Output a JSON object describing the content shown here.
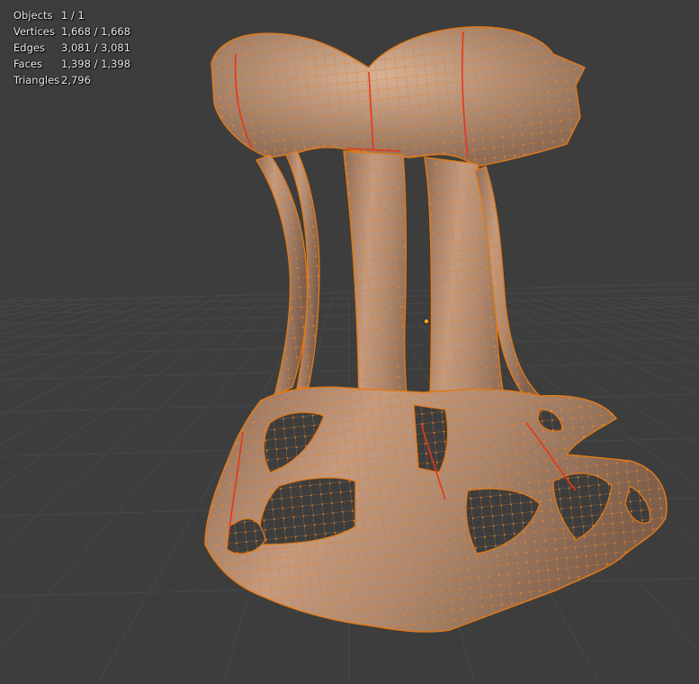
{
  "overlay": {
    "stats": [
      {
        "label": "Objects",
        "value": "1 / 1"
      },
      {
        "label": "Vertices",
        "value": "1,668 / 1,668"
      },
      {
        "label": "Edges",
        "value": "3,081 / 3,081"
      },
      {
        "label": "Faces",
        "value": "1,398 / 1,398"
      },
      {
        "label": "Triangles",
        "value": "2,796"
      }
    ]
  },
  "colors": {
    "background": "#3d3d3d",
    "grid": "#474747",
    "mesh_fill": "#a8836a",
    "mesh_edge": "#e07a18",
    "vertex": "#ff8a1e",
    "seam": "#e8361a"
  }
}
